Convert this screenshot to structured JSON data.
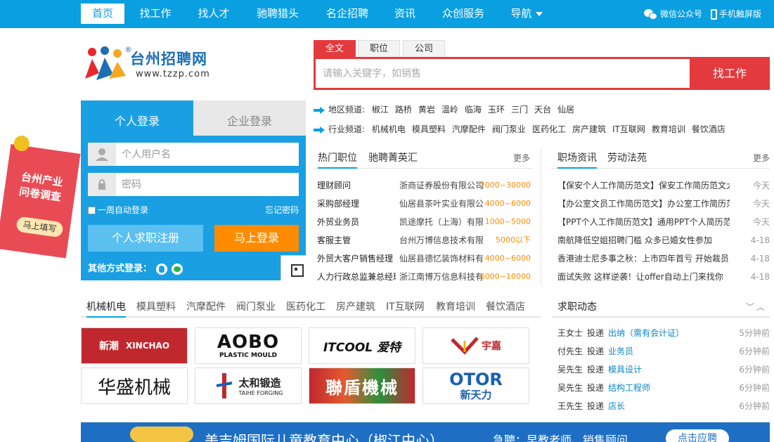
{
  "nav": {
    "items": [
      "首页",
      "找工作",
      "找人才",
      "驰聘猎头",
      "名企招聘",
      "资讯",
      "众创服务",
      "导航"
    ],
    "wechat": "微信公众号",
    "mobile": "手机触屏版"
  },
  "logo": {
    "name": "台州招聘网",
    "reg": "®",
    "url": "www.tzzp.com"
  },
  "search": {
    "tabs": [
      "全文",
      "职位",
      "公司"
    ],
    "placeholder": "请输入关键字，如销售",
    "button": "找工作"
  },
  "channels": {
    "region_label": "地区频道:",
    "regions": [
      "椒江",
      "路桥",
      "黄岩",
      "温岭",
      "临海",
      "玉环",
      "三门",
      "天台",
      "仙居"
    ],
    "industry_label": "行业频道:",
    "industries": [
      "机械机电",
      "模具塑料",
      "汽摩配件",
      "阀门泵业",
      "医药化工",
      "房产建筑",
      "IT互联网",
      "教育培训",
      "餐饮酒店"
    ]
  },
  "login": {
    "tab_personal": "个人登录",
    "tab_company": "企业登录",
    "user_placeholder": "个人用户名",
    "pass_placeholder": "密码",
    "remember": "一周自动登录",
    "forgot": "忘记密码",
    "register": "个人求职注册",
    "login_now": "马上登录",
    "other": "其他方式登录："
  },
  "survey": {
    "text1": "台州产业",
    "text2": "问卷调查",
    "button": "马上填写"
  },
  "jobs": {
    "tabs": [
      "热门职位",
      "驰聘菁英汇"
    ],
    "more": "更多",
    "rows": [
      {
        "title": "理财顾问",
        "company": "浙商证券股份有限公司",
        "salary": "2000~30000"
      },
      {
        "title": "采购部经理",
        "company": "仙居县茶叶实业有限公司",
        "salary": "4000~6000"
      },
      {
        "title": "外贸业务员",
        "company": "凯途摩托（上海）有限公司",
        "salary": "1000~5000"
      },
      {
        "title": "客服主管",
        "company": "台州万博信息技术有限公司",
        "salary": "5000以下"
      },
      {
        "title": "外贸大客户销售经理",
        "company": "仙居县德忆装饰材料有限公司",
        "salary": "4000~6000"
      },
      {
        "title": "人力行政总监兼总经理助理",
        "company": "浙江南博万信息科技有限公司",
        "salary": "6000~10000"
      }
    ]
  },
  "news": {
    "tabs": [
      "职场资讯",
      "劳动法苑"
    ],
    "more": "更多",
    "rows": [
      {
        "title": "【保安个人工作简历范文】保安工作简历范文大全",
        "date": "今天"
      },
      {
        "title": "【办公室文员工作简历范文】办公室工作简历范文",
        "date": "今天"
      },
      {
        "title": "【PPT个人工作简历范文】通用PPT个人简历范文下载",
        "date": "今天"
      },
      {
        "title": "南航降低空姐招聘门槛 众多已婚女性参加",
        "date": "4-18"
      },
      {
        "title": "香港迪士尼多事之秋：上市四年首亏 开始裁员",
        "date": "4-18"
      },
      {
        "title": "面试失败 这样逆袭！让offer自动上门来找你",
        "date": "4-18"
      }
    ]
  },
  "industry": {
    "tabs": [
      "机械机电",
      "模具塑料",
      "汽摩配件",
      "阀门泵业",
      "医药化工",
      "房产建筑",
      "IT互联网",
      "教育培训",
      "餐饮酒店"
    ],
    "logos": [
      {
        "text": "XINCHAO",
        "sub": "新潮",
        "bg": "#c0282e",
        "fg": "#ffffff"
      },
      {
        "text": "AOBO",
        "sub": "PLASTIC MOULD",
        "bg": "#ffffff",
        "fg": "#111111"
      },
      {
        "text": "ITCOOL 爱特",
        "sub": "",
        "bg": "#ffffff",
        "fg": "#111111"
      },
      {
        "text": "宇嘉",
        "sub": "",
        "bg": "#ffffff",
        "fg": "#c0282e"
      },
      {
        "text": "华盛机械",
        "sub": "",
        "bg": "#ffffff",
        "fg": "#111111"
      },
      {
        "text": "太和锻造",
        "sub": "TAIHE FORGING",
        "bg": "#ffffff",
        "fg": "#222222"
      },
      {
        "text": "聯盾機械",
        "sub": "",
        "bg": "#c0282e",
        "fg": "#ffffff"
      },
      {
        "text": "OTOR",
        "sub": "新天力",
        "bg": "#ffffff",
        "fg": "#1a5fb4"
      }
    ]
  },
  "dynamics": {
    "title": "求职动态",
    "verb": "投递",
    "rows": [
      {
        "name": "王女士",
        "position": "出纳（需有会计证）",
        "time": "5分钟前"
      },
      {
        "name": "付先生",
        "position": "业务员",
        "time": "6分钟前"
      },
      {
        "name": "吴先生",
        "position": "模具设计",
        "time": "6分钟前"
      },
      {
        "name": "吴先生",
        "position": "结构工程师",
        "time": "6分钟前"
      },
      {
        "name": "王先生",
        "position": "店长",
        "time": "6分钟前"
      }
    ]
  },
  "banner": {
    "title": "美吉姆国际儿童教育中心（椒江中心）",
    "sub": "急聘：早教老师、销售顾问",
    "button": "点击应聘"
  },
  "colors": {
    "primary": "#0a9fe0",
    "accent": "#e33a3e",
    "orange": "#ff8c00"
  }
}
